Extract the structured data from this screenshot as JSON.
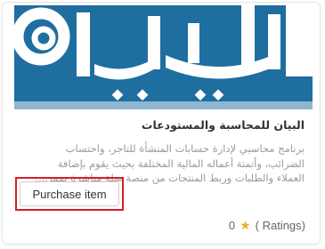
{
  "product": {
    "title": "البيان للمحاسبة والمستودعات",
    "description_lines": [
      "برنامج محاسبي لإدارة حسابات المنشأة للتاجر، واحتساب",
      "الضرائب، وأتمتة أعماله المالية المختلفة بحيث يقوم بإضافة",
      "العملاء والطلبات وربط المنتجات من منصة سلة مباشرة ضمن..."
    ],
    "logo_text": "البيان",
    "purchase_label": "Purchase item",
    "rating_count": "0",
    "ratings_label": "( Ratings)",
    "star_icon": "star-icon"
  },
  "colors": {
    "thumb_bg": "#1f6ea0",
    "highlight_border": "#d41e2b",
    "star": "#f2b01e"
  }
}
